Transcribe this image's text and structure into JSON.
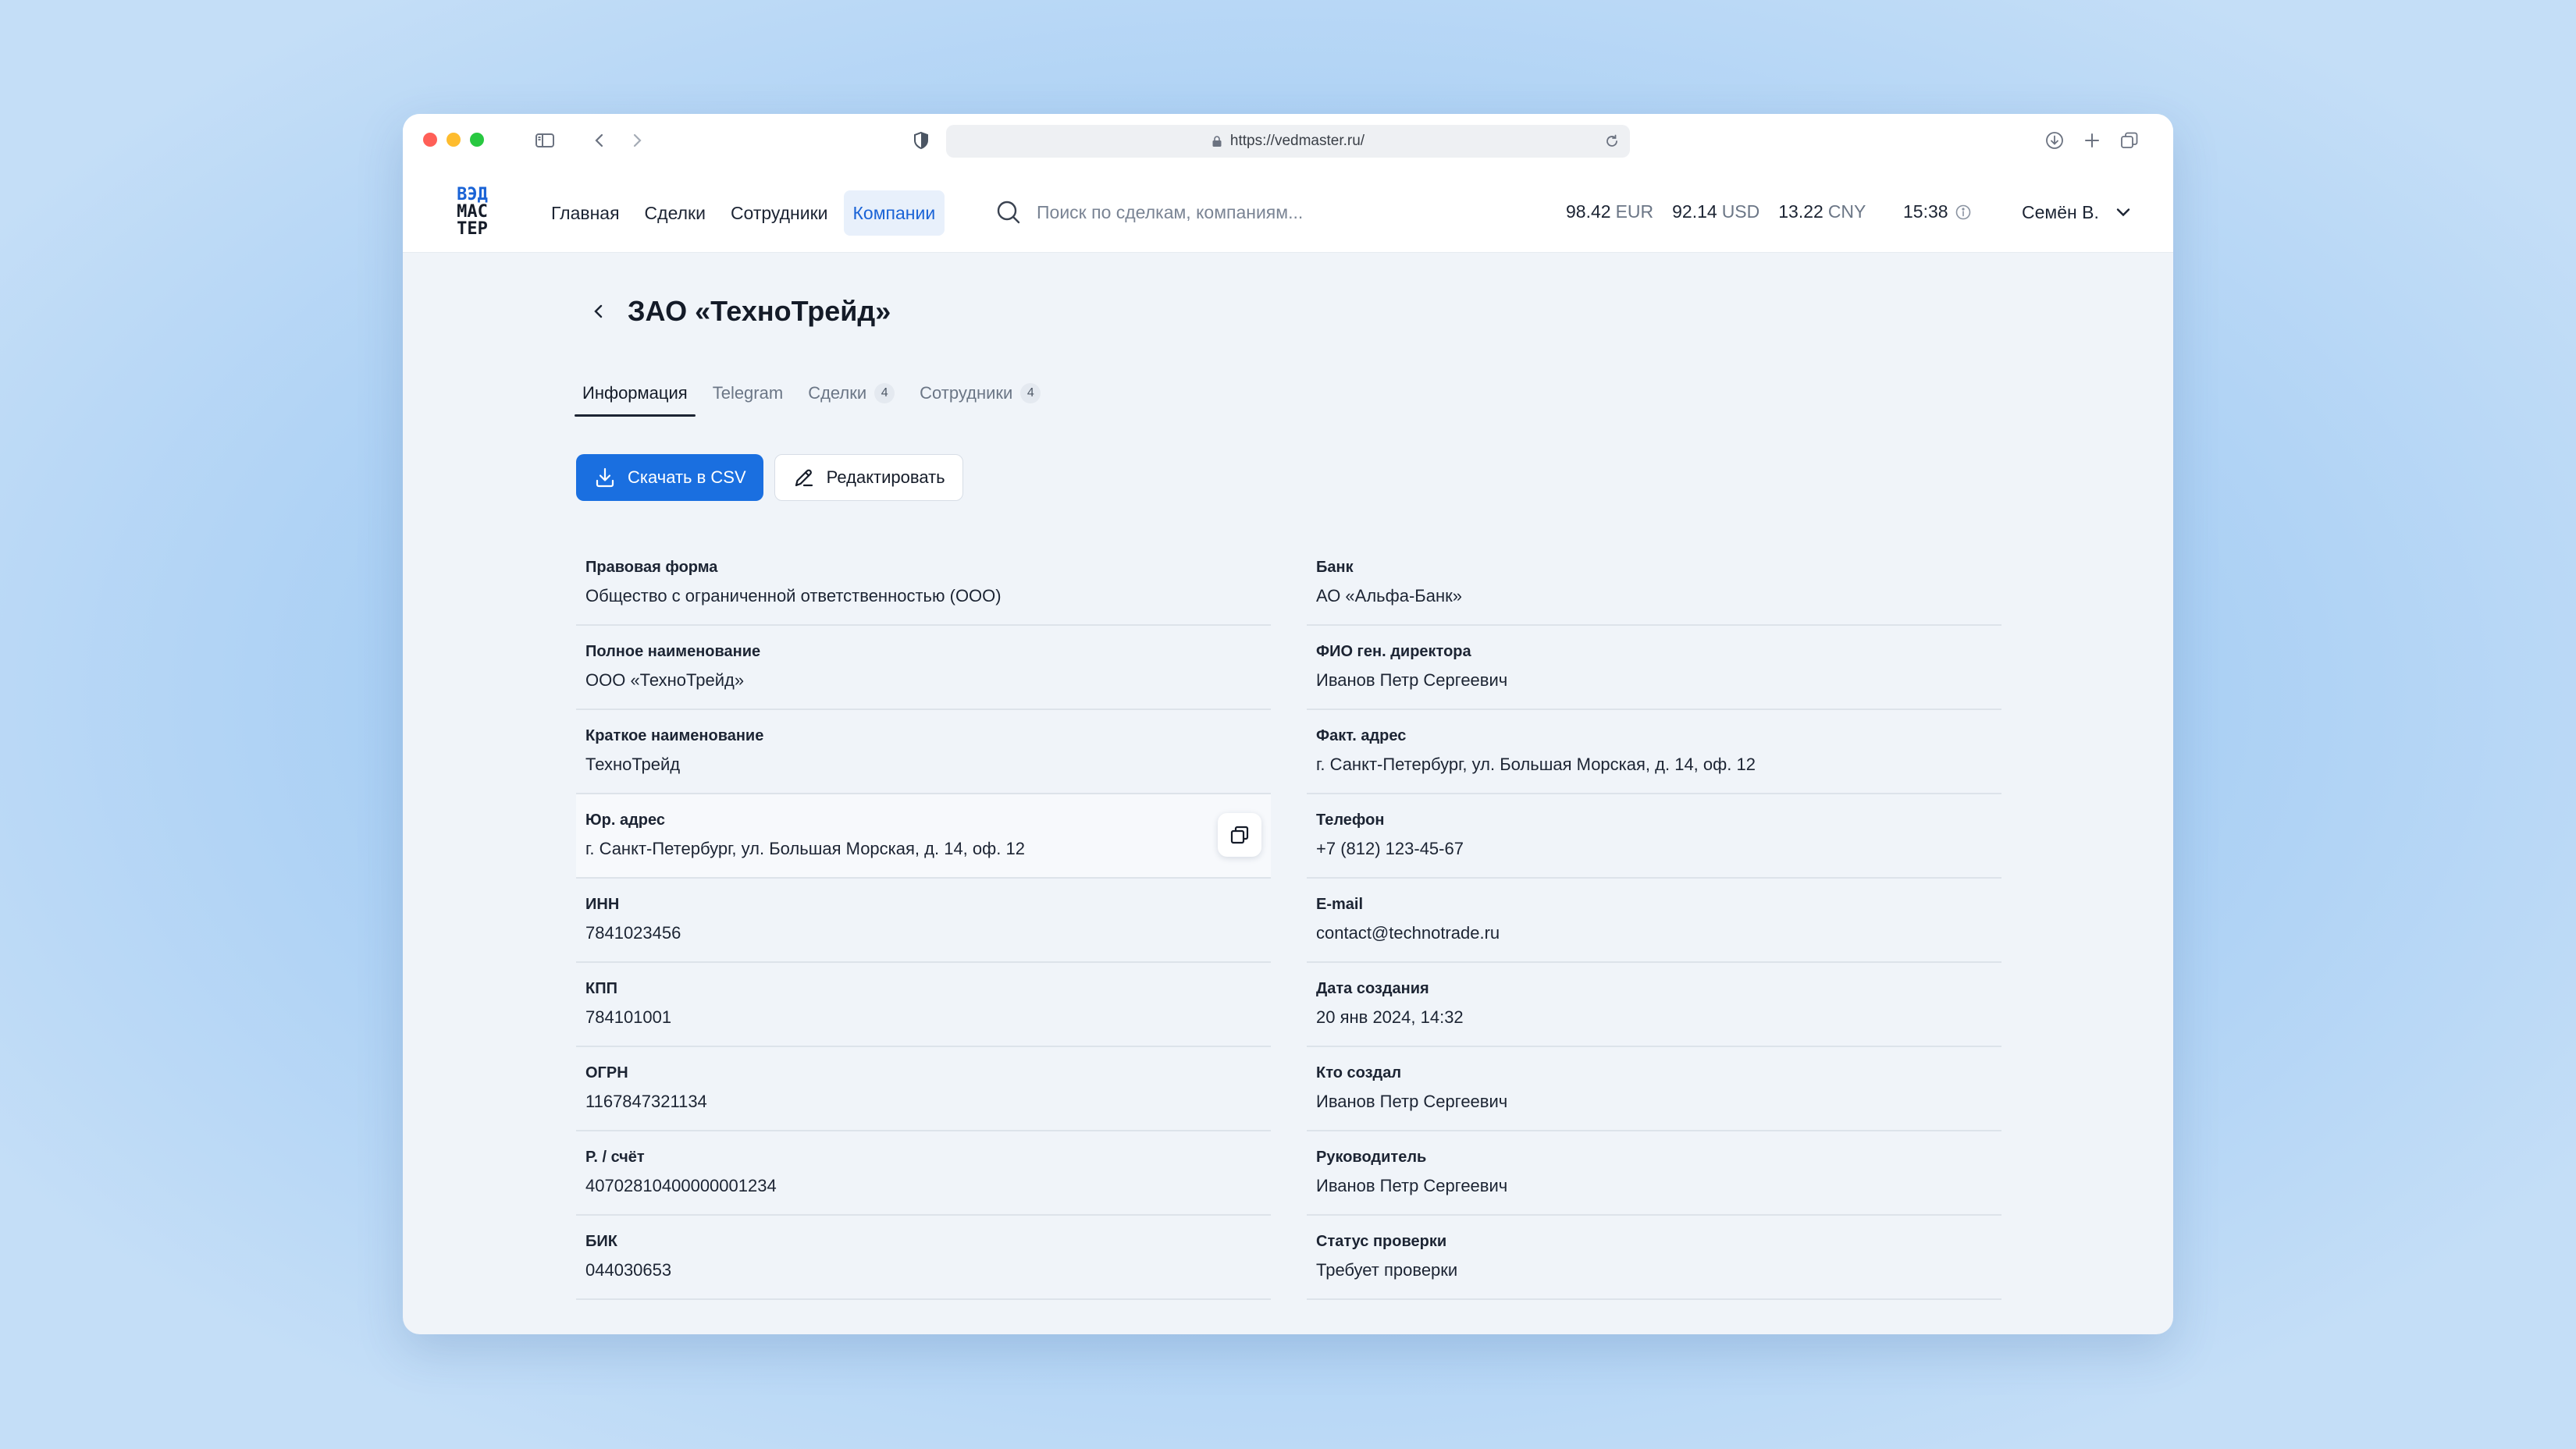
{
  "browser": {
    "url": "https://vedmaster.ru/"
  },
  "app": {
    "logo_lines": [
      "ВЭД",
      "МАС",
      "ТЕР"
    ],
    "nav": [
      {
        "label": "Главная",
        "active": false
      },
      {
        "label": "Сделки",
        "active": false
      },
      {
        "label": "Сотрудники",
        "active": false
      },
      {
        "label": "Компании",
        "active": true
      }
    ],
    "search_placeholder": "Поиск по сделкам, компаниям...",
    "rates": [
      {
        "value": "98.42",
        "currency": "EUR"
      },
      {
        "value": "92.14",
        "currency": "USD"
      },
      {
        "value": "13.22",
        "currency": "CNY"
      }
    ],
    "time": "15:38",
    "user": "Семён В."
  },
  "page": {
    "title": "ЗАО «ТехноТрейд»",
    "tabs": [
      {
        "label": "Информация",
        "count": null,
        "active": true
      },
      {
        "label": "Telegram",
        "count": null,
        "active": false
      },
      {
        "label": "Сделки",
        "count": "4",
        "active": false
      },
      {
        "label": "Сотрудники",
        "count": "4",
        "active": false
      }
    ],
    "download_button": "Скачать в CSV",
    "edit_button": "Редактировать",
    "left_fields": [
      {
        "label": "Правовая форма",
        "value": "Общество с ограниченной ответственностью (ООО)"
      },
      {
        "label": "Полное наименование",
        "value": "ООО «ТехноТрейд»"
      },
      {
        "label": "Краткое наименование",
        "value": "ТехноТрейд"
      },
      {
        "label": "Юр. адрес",
        "value": "г. Санкт-Петербург, ул. Большая Морская, д. 14, оф. 12"
      },
      {
        "label": "ИНН",
        "value": "7841023456"
      },
      {
        "label": "КПП",
        "value": "784101001"
      },
      {
        "label": "ОГРН",
        "value": "1167847321134"
      },
      {
        "label": "Р. / счёт",
        "value": "40702810400000001234"
      },
      {
        "label": "БИК",
        "value": "044030653"
      }
    ],
    "right_fields": [
      {
        "label": "Банк",
        "value": "АО «Альфа-Банк»"
      },
      {
        "label": "ФИО ген. директора",
        "value": "Иванов Петр Сергеевич"
      },
      {
        "label": "Факт. адрес",
        "value": "г. Санкт-Петербург, ул. Большая Морская, д. 14, оф. 12"
      },
      {
        "label": "Телефон",
        "value": "+7 (812) 123-45-67"
      },
      {
        "label": "E-mail",
        "value": "contact@technotrade.ru"
      },
      {
        "label": "Дата создания",
        "value": "20 янв 2024, 14:32"
      },
      {
        "label": "Кто создал",
        "value": "Иванов Петр Сергеевич"
      },
      {
        "label": "Руководитель",
        "value": "Иванов Петр Сергеевич"
      },
      {
        "label": "Статус проверки",
        "value": "Требует проверки"
      }
    ]
  },
  "colors": {
    "accent": "#1a6fe0",
    "nav_active": "#1a63d6",
    "background": "#f0f4f9"
  }
}
